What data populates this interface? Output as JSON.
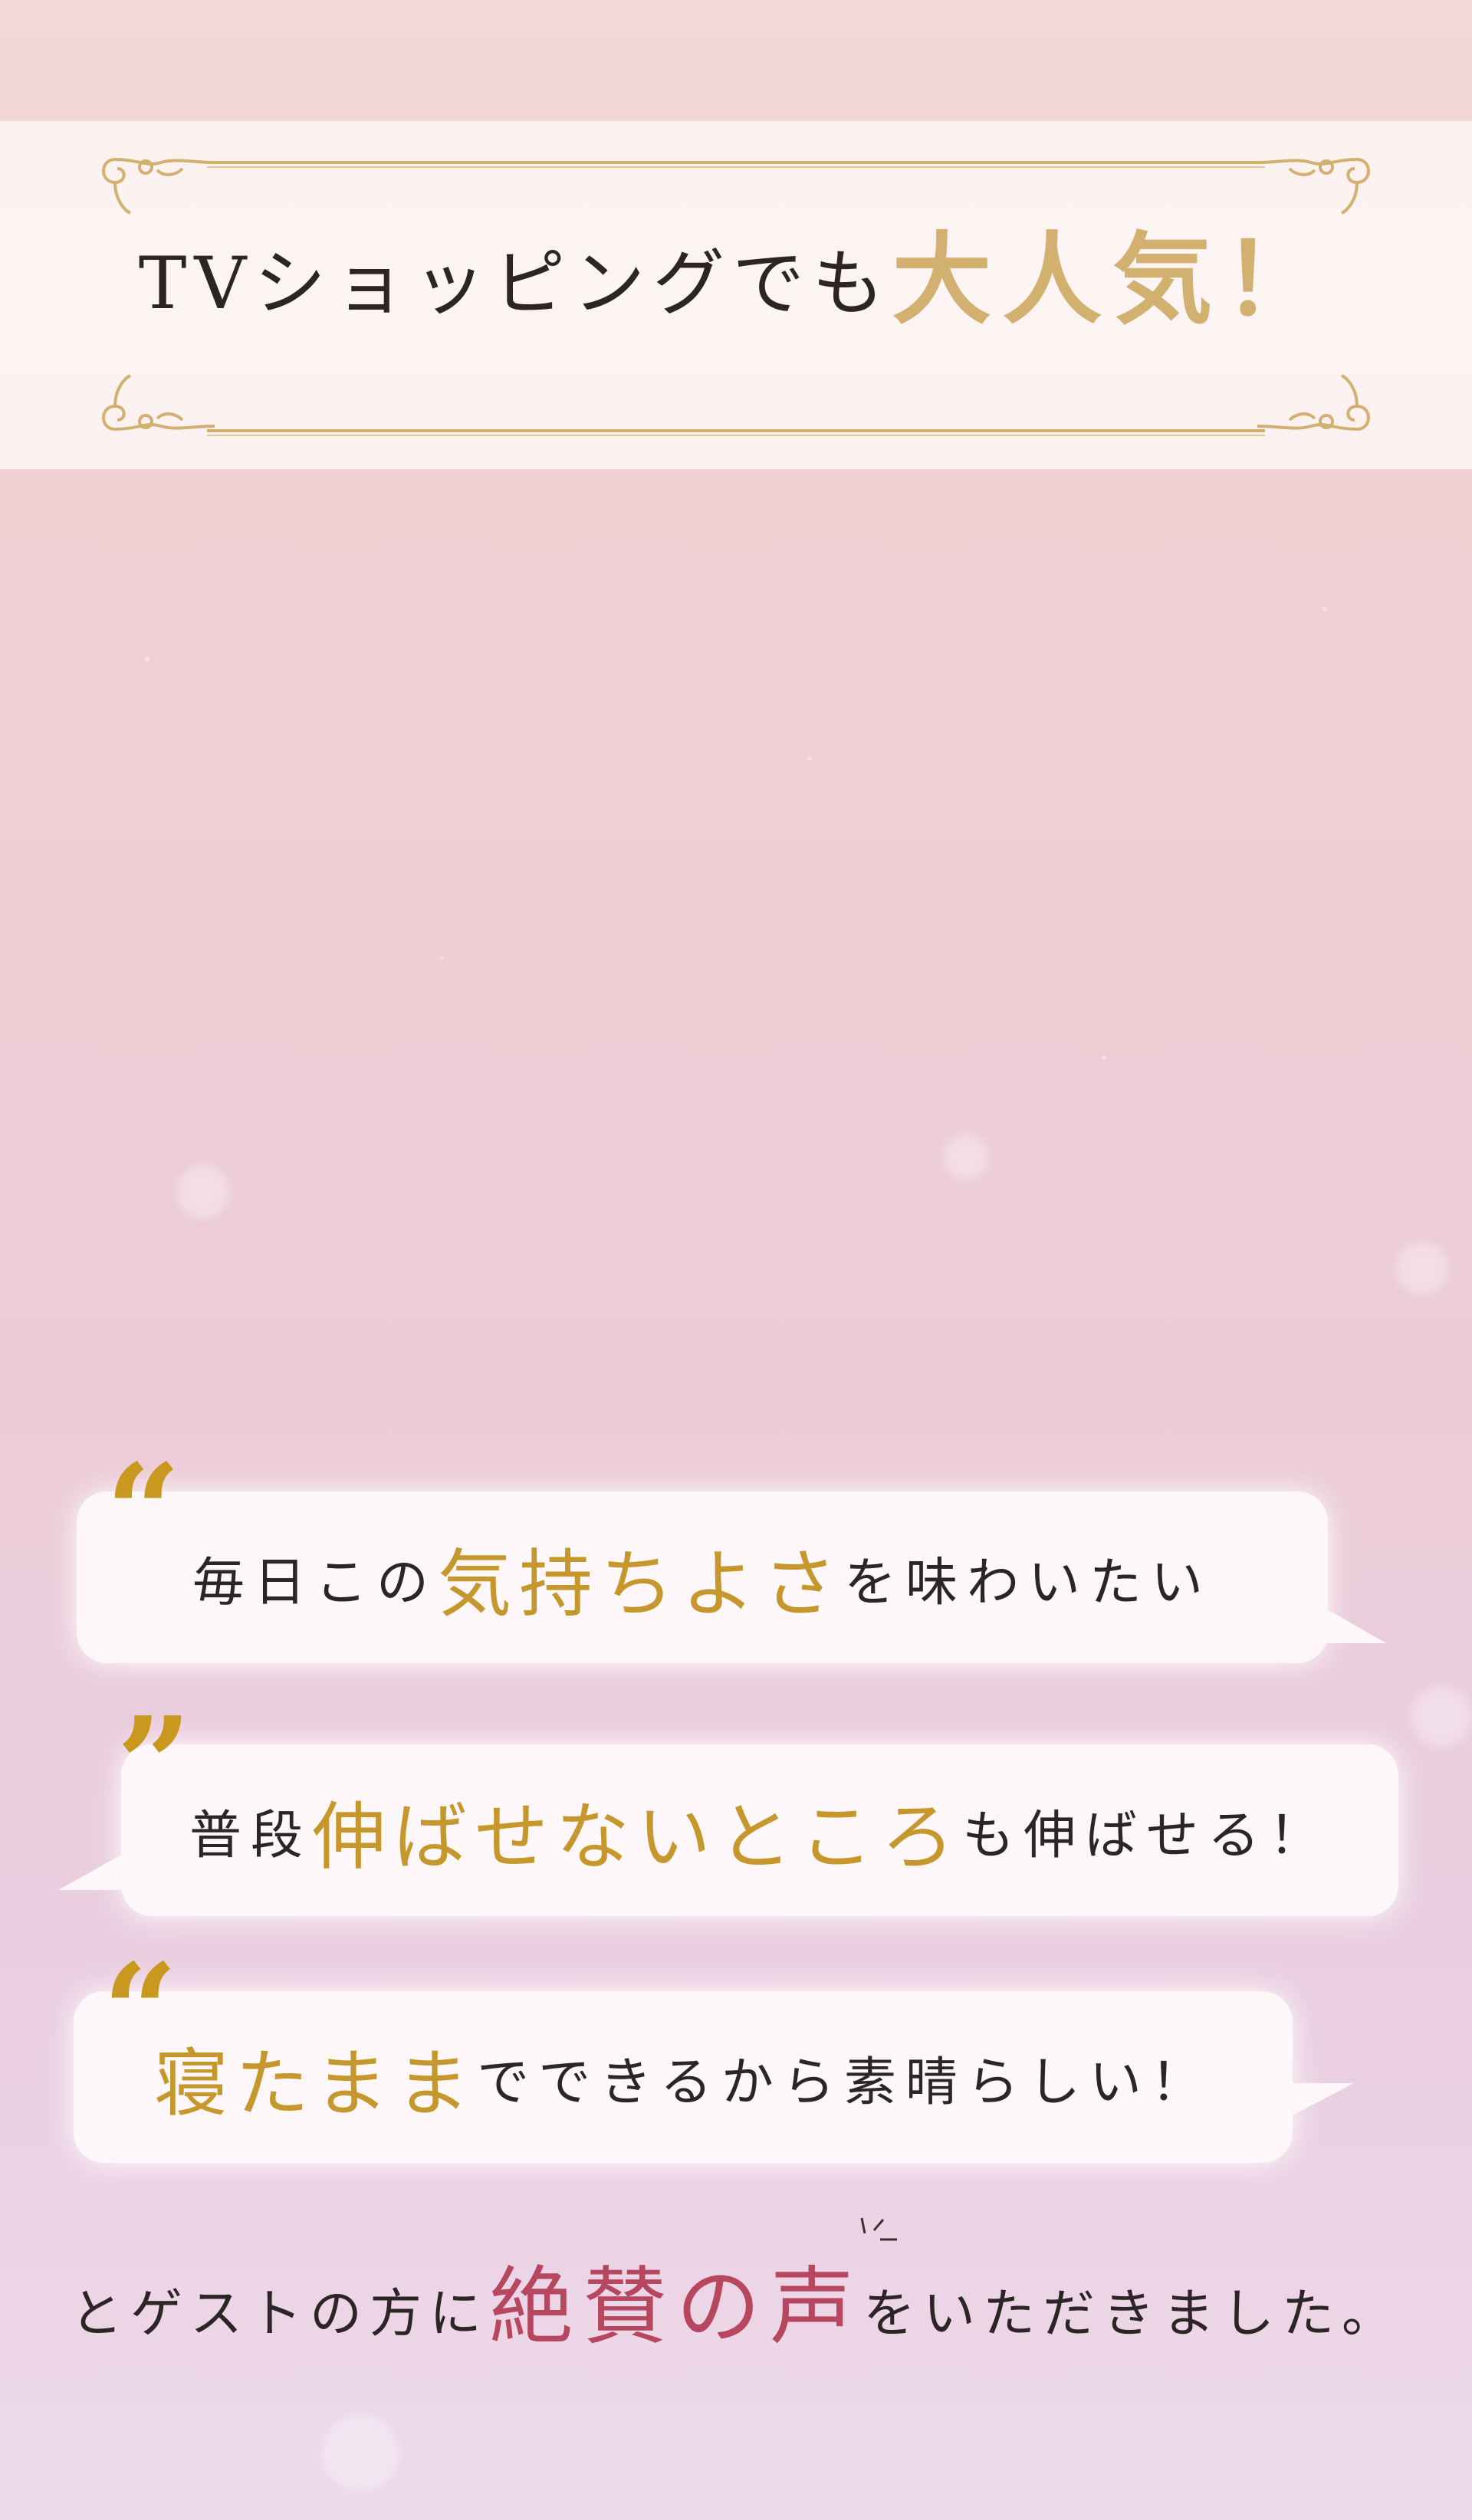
{
  "header": {
    "headline_main": "TVショッピングでも",
    "headline_accent": "大人気！"
  },
  "testimonials": [
    {
      "before": "毎日この",
      "highlight": "気持ちよさ",
      "after": "を味わいたい"
    },
    {
      "before": "普段",
      "highlight": "伸ばせないところ",
      "after": "も伸ばせる！"
    },
    {
      "before": "",
      "highlight": "寝たまま",
      "after": "でできるから素晴らしい！"
    }
  ],
  "closing": {
    "before": "とゲストの方に",
    "praise": "絶賛の声",
    "after": "をいただきました。"
  },
  "colors": {
    "gold_accent": "#d2b070",
    "quote_gold": "#c9981f",
    "highlight_gold": "#c5972c",
    "praise_rose": "#b6475e",
    "text_dark": "#2b2625"
  },
  "icons": {
    "quote_open": "“",
    "quote_close": "”"
  }
}
